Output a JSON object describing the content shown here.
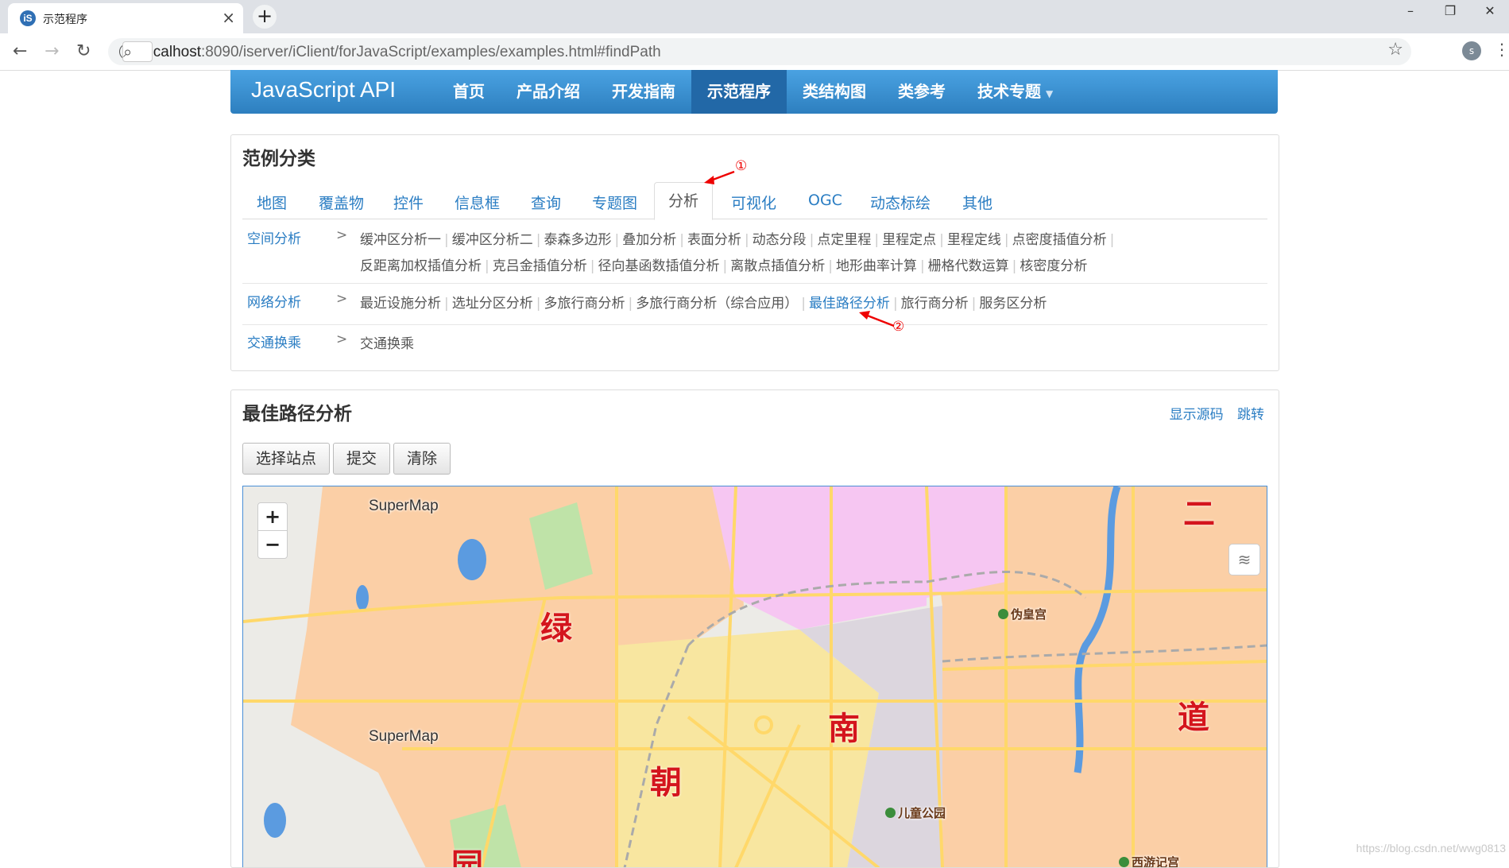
{
  "browser": {
    "tab_title": "示范程序",
    "tab_close": "×",
    "new_tab": "+",
    "favicon_text": "iS",
    "url_host": "localhost",
    "url_rest": ":8090/iserver/iClient/forJavaScript/examples/examples.html#findPath",
    "profile_initial": "s",
    "window_controls": [
      "–",
      "❐",
      "✕"
    ]
  },
  "site": {
    "brand": "JavaScript API",
    "nav": [
      "首页",
      "产品介绍",
      "开发指南",
      "示范程序",
      "类结构图",
      "类参考",
      "技术专题"
    ],
    "active_nav": "示范程序"
  },
  "categories": {
    "title": "范例分类",
    "tabs": [
      "地图",
      "覆盖物",
      "控件",
      "信息框",
      "查询",
      "专题图",
      "分析",
      "可视化",
      "OGC",
      "动态标绘",
      "其他"
    ],
    "active_tab": "分析",
    "rows": [
      {
        "name": "空间分析",
        "arrow": ">",
        "links": [
          "缓冲区分析一",
          "缓冲区分析二",
          "泰森多边形",
          "叠加分析",
          "表面分析",
          "动态分段",
          "点定里程",
          "里程定点",
          "里程定线",
          "点密度插值分析",
          "反距离加权插值分析",
          "克吕金插值分析",
          "径向基函数插值分析",
          "离散点插值分析",
          "地形曲率计算",
          "栅格代数运算",
          "核密度分析"
        ]
      },
      {
        "name": "网络分析",
        "arrow": ">",
        "links": [
          "最近设施分析",
          "选址分区分析",
          "多旅行商分析",
          "多旅行商分析（综合应用）",
          "最佳路径分析",
          "旅行商分析",
          "服务区分析"
        ],
        "highlight": "最佳路径分析"
      },
      {
        "name": "交通换乘",
        "arrow": ">",
        "links": [
          "交通换乘"
        ]
      }
    ],
    "annotation_1": "①",
    "annotation_2": "②"
  },
  "example": {
    "title": "最佳路径分析",
    "show_source": "显示源码",
    "jump": "跳转",
    "buttons": [
      "选择站点",
      "提交",
      "清除"
    ],
    "map": {
      "zoom_in": "+",
      "zoom_out": "−",
      "labels": [
        "SuperMap",
        "SuperMap"
      ],
      "big_chars": [
        "二",
        "绿",
        "南",
        "道",
        "朝",
        "园"
      ],
      "pois": [
        "伪皇宫",
        "儿童公园",
        "西游记宫"
      ],
      "watermark": "https://blog.csdn.net/wwg0813",
      "colors": {
        "district_orange": "#fbcfa6",
        "district_pink": "#f6c6f2",
        "district_yellow": "#f8e6a0",
        "district_grey": "#dcd6de",
        "road": "#ffd86a",
        "water": "#5b9be0",
        "green": "#bfe3a8"
      }
    }
  }
}
